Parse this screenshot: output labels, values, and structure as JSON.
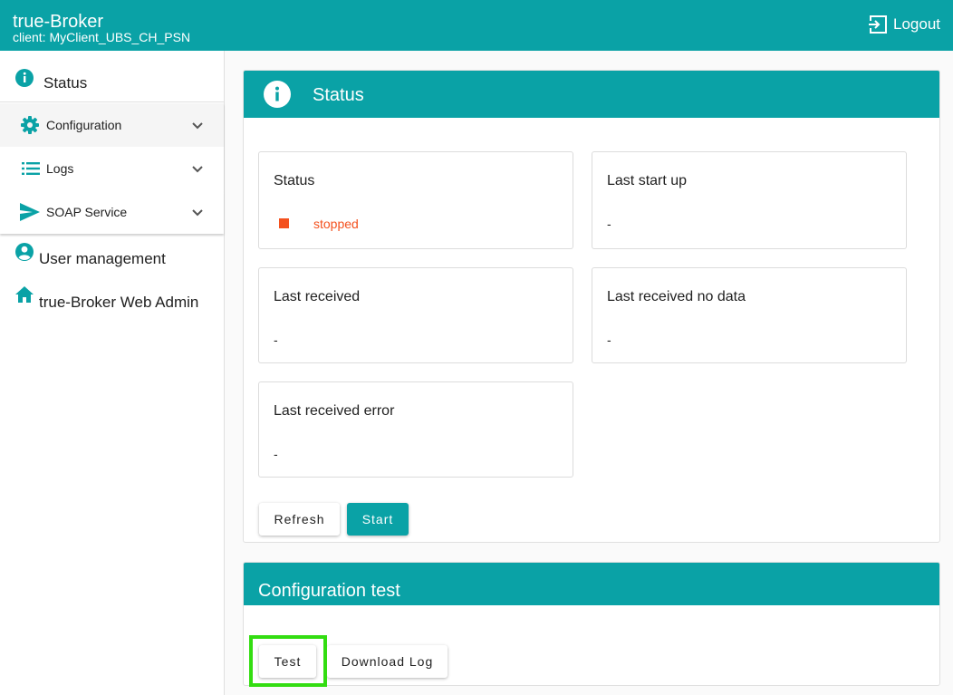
{
  "header": {
    "title": "true-Broker",
    "client": "client: MyClient_UBS_CH_PSN",
    "logout_label": "Logout"
  },
  "sidebar": {
    "items": [
      {
        "label": "Status",
        "icon": "info-icon"
      },
      {
        "label": "Configuration",
        "icon": "gear-icon"
      },
      {
        "label": "Logs",
        "icon": "list-icon"
      },
      {
        "label": "SOAP Service",
        "icon": "send-icon"
      },
      {
        "label": "User management",
        "icon": "account-icon"
      },
      {
        "label": "true-Broker Web Admin",
        "icon": "home-icon"
      }
    ]
  },
  "status_card": {
    "title": "Status",
    "tiles": [
      {
        "label": "Status",
        "value": "stopped"
      },
      {
        "label": "Last start up",
        "value": "-"
      },
      {
        "label": "Last received",
        "value": "-"
      },
      {
        "label": "Last received no data",
        "value": "-"
      },
      {
        "label": "Last received error",
        "value": "-"
      }
    ],
    "refresh_label": "Refresh",
    "start_label": "Start"
  },
  "config_card": {
    "title": "Configuration test",
    "test_label": "Test",
    "download_label": "Download Log"
  },
  "colors": {
    "primary": "#0aa2a6",
    "stopped": "#f4511e",
    "highlight": "#33dd11"
  }
}
